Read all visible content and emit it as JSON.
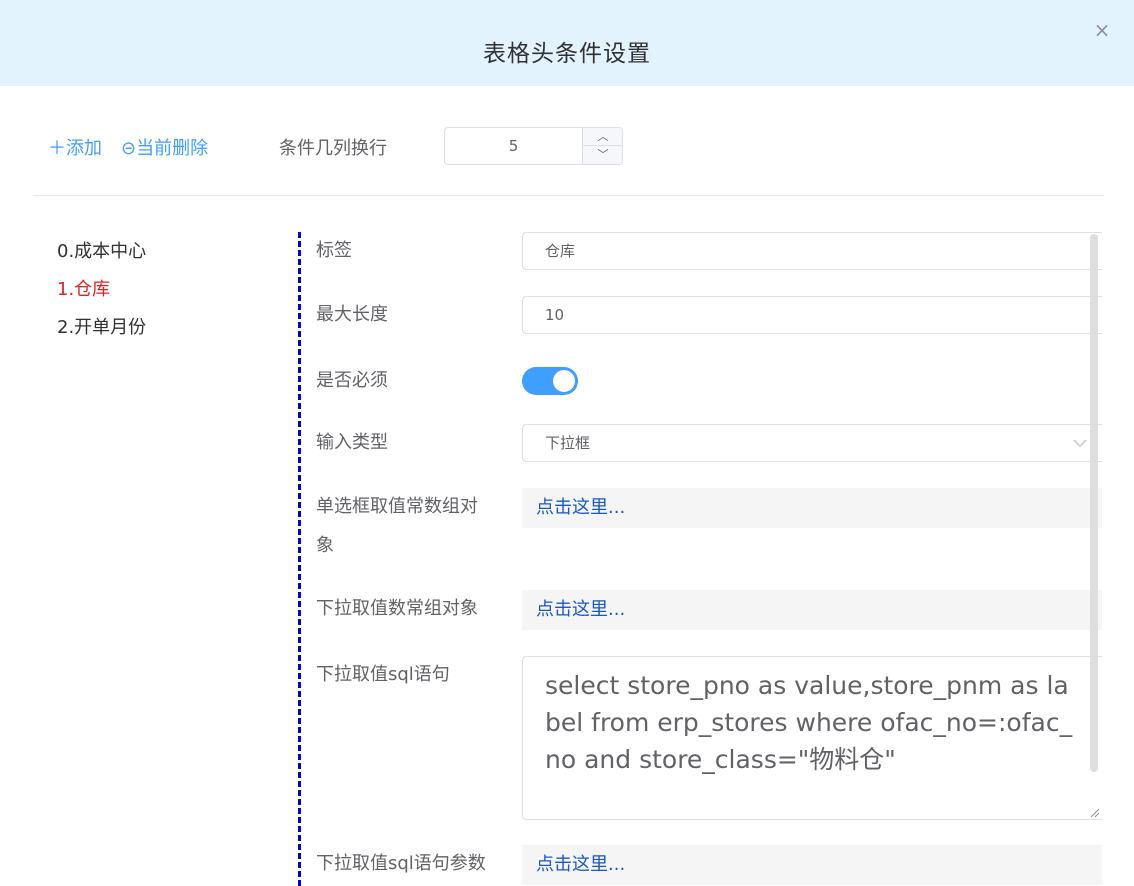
{
  "dialog": {
    "title": "表格头条件设置",
    "close_icon": "×"
  },
  "toolbar": {
    "add_label": "＋添加",
    "delete_label": "⊝当前删除",
    "columns_label": "条件几列换行",
    "columns_value": "5",
    "step_up_icon": "︿",
    "step_down_icon": "﹀"
  },
  "conditions": [
    {
      "label": "0.成本中心",
      "active": false
    },
    {
      "label": "1.仓库",
      "active": true
    },
    {
      "label": "2.开单月份",
      "active": false
    }
  ],
  "form": {
    "tag_label": "标签",
    "tag_value": "仓库",
    "maxlen_label": "最大长度",
    "maxlen_value": "10",
    "required_label": "是否必须",
    "required_on": true,
    "input_type_label": "输入类型",
    "input_type_value": "下拉框",
    "radio_const_label_1": "单选框取值常数组对",
    "radio_const_label_2": "象",
    "radio_const_link": "点击这里...",
    "dropdown_const_label": "下拉取值数常组对象",
    "dropdown_const_link": "点击这里...",
    "sql_label": "下拉取值sql语句",
    "sql_value": "select store_pno as value,store_pnm as label from erp_stores where ofac_no=:ofac_no and store_class=\"物料仓\"",
    "sql_params_label": "下拉取值sql语句参数",
    "sql_params_link": "点击这里..."
  },
  "colors": {
    "header_bg": "#e3f3fd",
    "accent": "#409eff",
    "active_item": "#e02020",
    "link": "#1a56c8",
    "separator": "#0000cc"
  },
  "icons": {
    "close": "close-icon",
    "add": "plus-icon",
    "delete": "minus-circle-icon",
    "select": "chevron-down-icon",
    "resize": "resize-handle-icon"
  }
}
